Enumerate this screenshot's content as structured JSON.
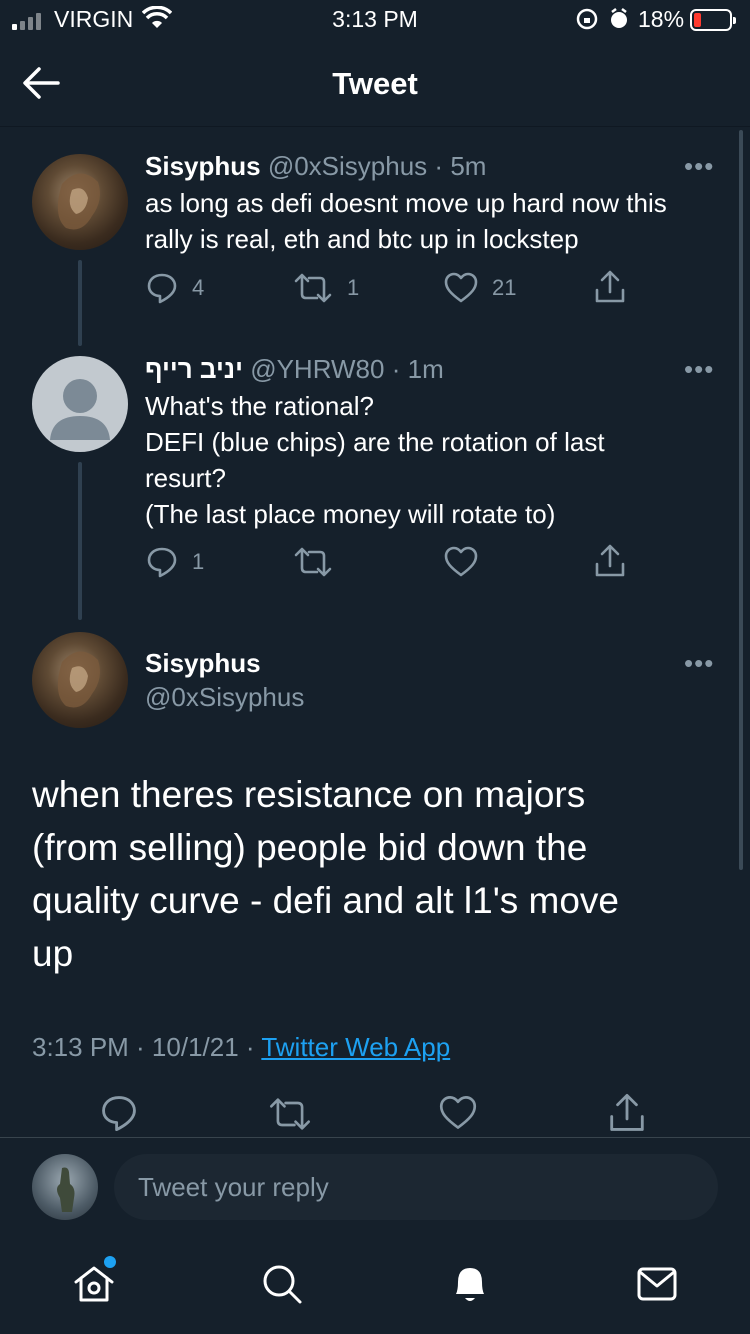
{
  "status_bar": {
    "carrier": "VIRGIN",
    "time": "3:13 PM",
    "battery_pct": "18%",
    "battery_color": "#ff3b30"
  },
  "header": {
    "title": "Tweet",
    "back_icon": "arrow-left-icon"
  },
  "thread": [
    {
      "name": "Sisyphus",
      "handle": "@0xSisyphus",
      "separator": "·",
      "time": "5m",
      "text_lines": [
        "as long as defi doesnt move up hard now this",
        "rally is real, eth and btc up in lockstep"
      ],
      "reply_count": "4",
      "retweet_count": "1",
      "like_count": "21"
    },
    {
      "name": "יניב רייף",
      "handle": "@YHRW80",
      "separator": "·",
      "time": "1m",
      "text_lines": [
        "What's the rational?",
        "DEFI (blue chips) are the rotation of last",
        "resurt?",
        "(The last place money will rotate to)"
      ],
      "reply_count": "1",
      "retweet_count": "",
      "like_count": ""
    }
  ],
  "main_tweet": {
    "name": "Sisyphus",
    "handle": "@0xSisyphus",
    "text_lines": [
      "when theres resistance on majors",
      "(from selling) people bid down the",
      "quality curve - defi and alt l1's move",
      "up"
    ],
    "timestamp": "3:13 PM · 10/1/21 · ",
    "source": "Twitter Web App"
  },
  "reply_box": {
    "placeholder": "Tweet your reply"
  },
  "more_label": "•••",
  "colors": {
    "background": "#15202b",
    "secondary_text": "#8899a6",
    "accent": "#1da1f2"
  },
  "bottom_nav": [
    "home-icon",
    "search-icon",
    "notifications-icon",
    "messages-icon"
  ]
}
